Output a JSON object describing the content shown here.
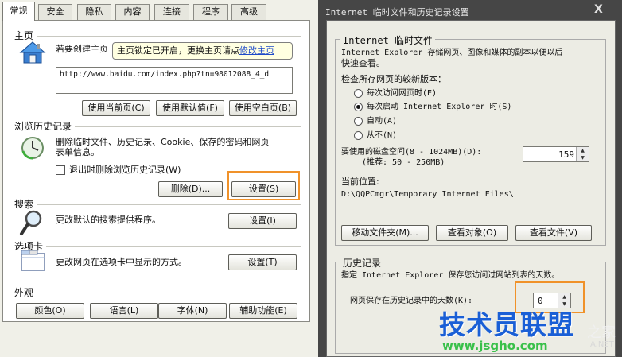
{
  "left_dialog": {
    "tabs": [
      {
        "label": "常规",
        "active": true
      },
      {
        "label": "安全"
      },
      {
        "label": "隐私"
      },
      {
        "label": "内容"
      },
      {
        "label": "连接"
      },
      {
        "label": "程序"
      },
      {
        "label": "高级"
      }
    ],
    "home": {
      "title": "主页",
      "desc": "若要创建主页",
      "tooltip_text": "主页锁定已开启，更换主页请点",
      "tooltip_link": "修改主页",
      "url_value": "http://www.baidu.com/index.php?tn=98012088_4_d",
      "btn_current": "使用当前页(C)",
      "btn_default": "使用默认值(F)",
      "btn_blank": "使用空白页(B)"
    },
    "history": {
      "title": "浏览历史记录",
      "desc_line1": "删除临时文件、历史记录、Cookie、保存的密码和网页",
      "desc_line2": "表单信息。",
      "checkbox_label": "退出时删除浏览历史记录(W)",
      "btn_delete": "删除(D)...",
      "btn_settings": "设置(S)"
    },
    "search": {
      "title": "搜索",
      "desc": "更改默认的搜索提供程序。",
      "btn_settings": "设置(I)"
    },
    "tabs_section": {
      "title": "选项卡",
      "desc": "更改网页在选项卡中显示的方式。",
      "btn_settings": "设置(T)"
    },
    "appearance": {
      "title": "外观",
      "btn_colors": "颜色(O)",
      "btn_languages": "语言(L)",
      "btn_fonts": "字体(N)",
      "btn_accessibility": "辅助功能(E)"
    }
  },
  "right_dialog": {
    "title": "Internet 临时文件和历史记录设置",
    "close_glyph": "X",
    "temp_files": {
      "group_label": "Internet 临时文件",
      "desc_line1": "Internet Explorer 存储网页、图像和媒体的副本以便以后",
      "desc_line2": "快速查看。",
      "check_label": "检查所存网页的较新版本：",
      "options": [
        {
          "label": "每次访问网页时(E)",
          "selected": false
        },
        {
          "label": "每次启动 Internet Explorer 时(S)",
          "selected": true
        },
        {
          "label": "自动(A)",
          "selected": false
        },
        {
          "label": "从不(N)",
          "selected": false
        }
      ],
      "disk_label_line1": "要使用的磁盘空间(8 - 1024MB)(D):",
      "disk_label_line2": "(推荐: 50 - 250MB)",
      "disk_value": "159",
      "location_label": "当前位置:",
      "location_path": "D:\\QQPCmgr\\Temporary Internet Files\\",
      "btn_move": "移动文件夹(M)...",
      "btn_objects": "查看对象(O)",
      "btn_files": "查看文件(V)"
    },
    "history": {
      "group_label": "历史记录",
      "desc": "指定 Internet Explorer 保存您访问过网站列表的天数。",
      "days_label": "网页保存在历史记录中的天数(K):",
      "days_value": "0"
    }
  },
  "watermark": {
    "main": "技术员联盟",
    "url": "www.jsgho.com",
    "side": "之家",
    "net": "A.NET"
  },
  "colors": {
    "highlight_orange": "#f0922a",
    "watermark_blue": "#1a5fd6",
    "watermark_green": "#39c04a",
    "tooltip_bg": "#ffffe1"
  }
}
